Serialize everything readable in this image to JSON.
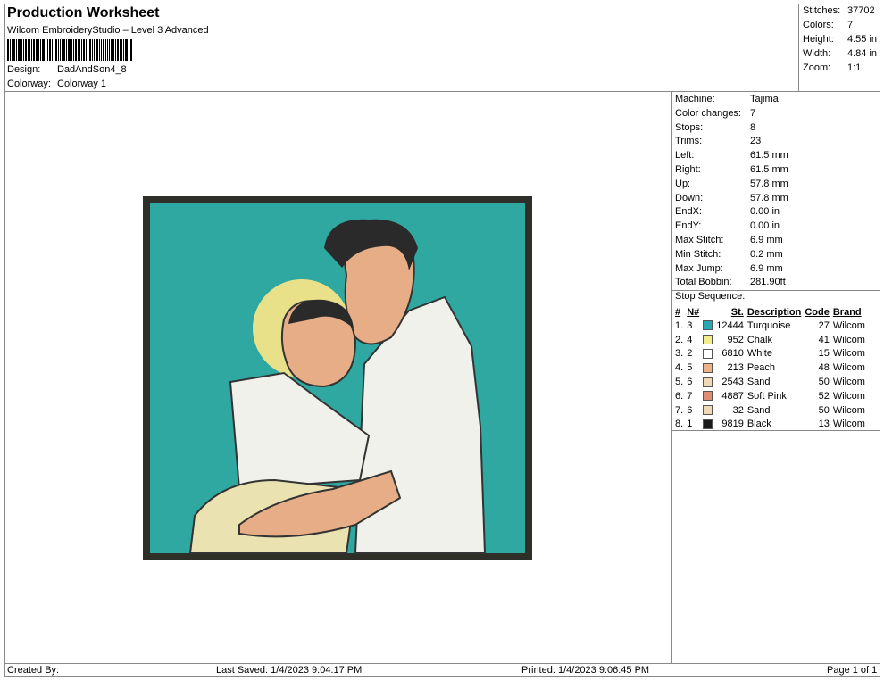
{
  "header": {
    "title": "Production Worksheet",
    "software": "Wilcom EmbroideryStudio – Level 3 Advanced",
    "design_label": "Design:",
    "design_value": "DadAndSon4_8",
    "colorway_label": "Colorway:",
    "colorway_value": "Colorway 1"
  },
  "summary": {
    "stitches_label": "Stitches:",
    "stitches": "37702",
    "colors_label": "Colors:",
    "colors": "7",
    "height_label": "Height:",
    "height": "4.55 in",
    "width_label": "Width:",
    "width": "4.84 in",
    "zoom_label": "Zoom:",
    "zoom": "1:1"
  },
  "machine_info": [
    {
      "label": "Machine:",
      "value": "Tajima"
    },
    {
      "label": "Color changes:",
      "value": "7"
    },
    {
      "label": "Stops:",
      "value": "8"
    },
    {
      "label": "Trims:",
      "value": "23"
    },
    {
      "label": "Left:",
      "value": "61.5 mm"
    },
    {
      "label": "Right:",
      "value": "61.5 mm"
    },
    {
      "label": "Up:",
      "value": "57.8 mm"
    },
    {
      "label": "Down:",
      "value": "57.8 mm"
    },
    {
      "label": "EndX:",
      "value": "0.00 in"
    },
    {
      "label": "EndY:",
      "value": "0.00 in"
    },
    {
      "label": "Max Stitch:",
      "value": "6.9 mm"
    },
    {
      "label": "Min Stitch:",
      "value": "0.2 mm"
    },
    {
      "label": "Max Jump:",
      "value": "6.9 mm"
    },
    {
      "label": "Total Bobbin:",
      "value": "281.90ft"
    }
  ],
  "stop_sequence": {
    "label": "Stop Sequence:",
    "headers": {
      "stop": "#",
      "needle": "N#",
      "stitches": "St.",
      "description": "Description",
      "code": "Code",
      "brand": "Brand"
    },
    "rows": [
      {
        "stop": "1.",
        "needle": "3",
        "color": "#2aa7b0",
        "stitches": "12444",
        "description": "Turquoise",
        "code": "27",
        "brand": "Wilcom"
      },
      {
        "stop": "2.",
        "needle": "4",
        "color": "#f2ee8a",
        "stitches": "952",
        "description": "Chalk",
        "code": "41",
        "brand": "Wilcom"
      },
      {
        "stop": "3.",
        "needle": "2",
        "color": "#ffffff",
        "stitches": "6810",
        "description": "White",
        "code": "15",
        "brand": "Wilcom"
      },
      {
        "stop": "4.",
        "needle": "5",
        "color": "#eab48a",
        "stitches": "213",
        "description": "Peach",
        "code": "48",
        "brand": "Wilcom"
      },
      {
        "stop": "5.",
        "needle": "6",
        "color": "#f3d8b6",
        "stitches": "2543",
        "description": "Sand",
        "code": "50",
        "brand": "Wilcom"
      },
      {
        "stop": "6.",
        "needle": "7",
        "color": "#e08d76",
        "stitches": "4887",
        "description": "Soft Pink",
        "code": "52",
        "brand": "Wilcom"
      },
      {
        "stop": "7.",
        "needle": "6",
        "color": "#f3d8b6",
        "stitches": "32",
        "description": "Sand",
        "code": "50",
        "brand": "Wilcom"
      },
      {
        "stop": "8.",
        "needle": "1",
        "color": "#1a1a1a",
        "stitches": "9819",
        "description": "Black",
        "code": "13",
        "brand": "Wilcom"
      }
    ]
  },
  "footer": {
    "created_by": "Created By:",
    "last_saved": "Last Saved: 1/4/2023 9:04:17 PM",
    "printed": "Printed: 1/4/2023 9:06:45 PM",
    "page": "Page 1 of 1"
  }
}
